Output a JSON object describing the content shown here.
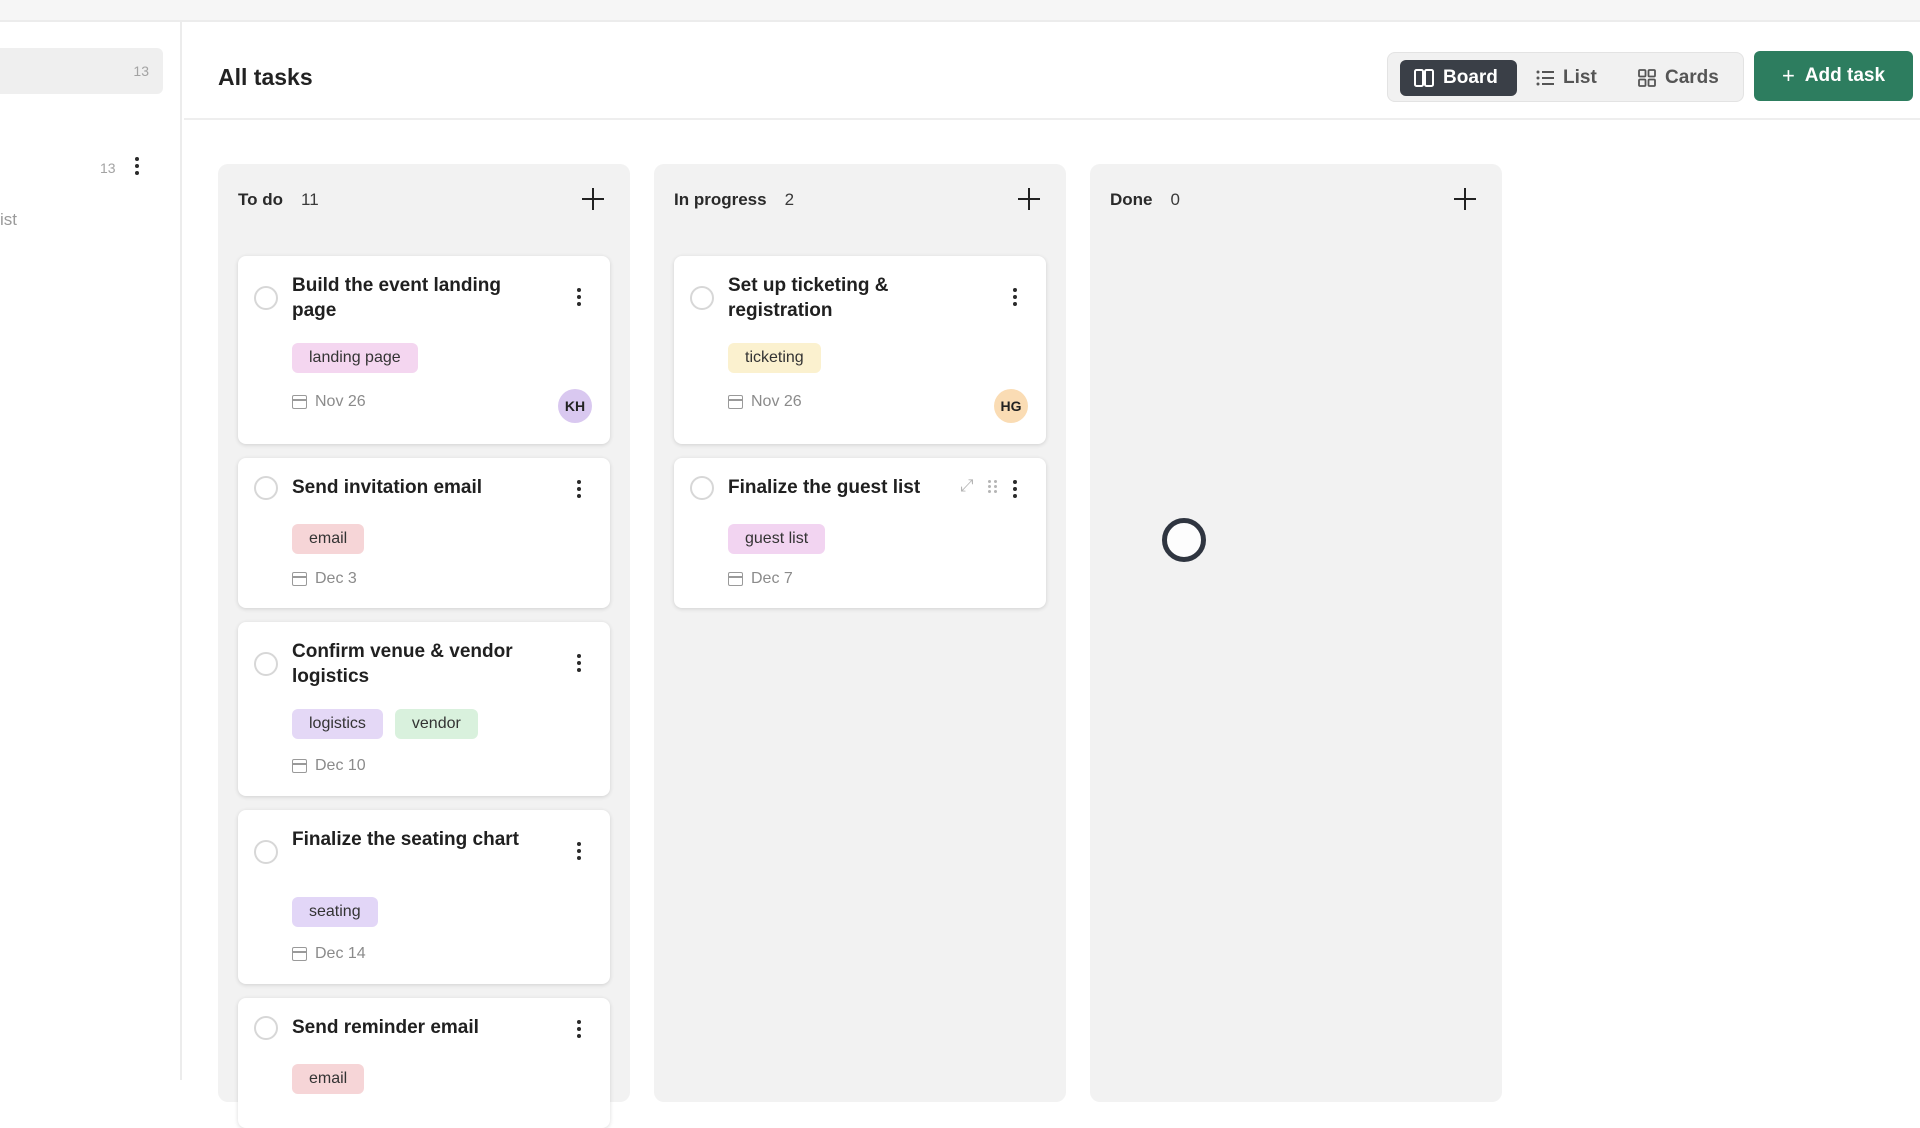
{
  "sidebar": {
    "selected_count": "13",
    "row2_count": "13",
    "partial_label": "ist"
  },
  "header": {
    "title": "All tasks",
    "views": [
      {
        "label": "Board",
        "icon": "board-columns-icon",
        "active": true
      },
      {
        "label": "List",
        "icon": "list-icon",
        "active": false
      },
      {
        "label": "Cards",
        "icon": "grid-cards-icon",
        "active": false
      }
    ],
    "add_task_label": "Add task",
    "add_task_icon": "+"
  },
  "columns": [
    {
      "title": "To do",
      "count": "11",
      "cards": [
        {
          "title": "Build the event landing page",
          "tags": [
            "landing page"
          ],
          "due": "Nov 26",
          "assignee": "KH"
        },
        {
          "title": "Send invitation email",
          "tags": [
            "email"
          ],
          "due": "Dec 3"
        },
        {
          "title": "Confirm venue & vendor logistics",
          "tags": [
            "logistics",
            "vendor"
          ],
          "due": "Dec 10"
        },
        {
          "title": "Finalize the seating chart",
          "tags": [
            "seating"
          ],
          "due": "Dec 14"
        },
        {
          "title": "Send reminder email",
          "tags": [
            "email"
          ]
        }
      ]
    },
    {
      "title": "In progress",
      "count": "2",
      "cards": [
        {
          "title": "Set up ticketing & registration",
          "tags": [
            "ticketing"
          ],
          "due": "Nov 26",
          "assignee": "HG"
        },
        {
          "title": "Finalize the guest list",
          "tags": [
            "guest list"
          ],
          "due": "Dec 7"
        }
      ]
    },
    {
      "title": "Done",
      "count": "0",
      "cards": []
    }
  ],
  "colors": {
    "primary_button": "#2d7d5f",
    "active_view": "#3a3f47",
    "tag_landing_page": "#f4d6f0",
    "tag_email": "#f6d5d7",
    "tag_logistics": "#e4d8f6",
    "tag_vendor": "#d9f1dd",
    "tag_seating": "#e2d6f7",
    "tag_ticketing": "#fbf1cf",
    "tag_guest_list": "#f2d4f1",
    "avatar_kh": "#d9c8f0",
    "avatar_hg": "#fadcb4"
  }
}
